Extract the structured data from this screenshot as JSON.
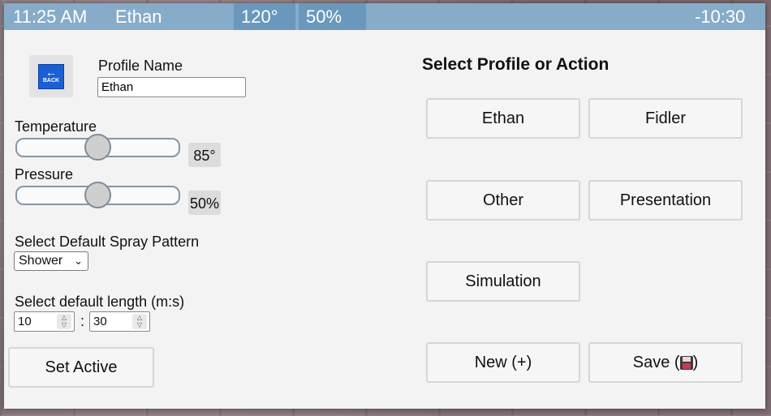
{
  "status_bar": {
    "time": "11:25 AM",
    "user": "Ethan",
    "temperature": "120°",
    "pressure": "50%",
    "remaining": "-10:30"
  },
  "left": {
    "profile_name_label": "Profile Name",
    "profile_name_value": "Ethan",
    "back_label": "BACK",
    "temperature_label": "Temperature",
    "temperature_value": "85°",
    "temperature_level": 0.5,
    "pressure_label": "Pressure",
    "pressure_value": "50%",
    "pressure_level": 0.5,
    "spray_label": "Select Default Spray Pattern",
    "spray_value": "Shower",
    "length_label": "Select default length (m:s)",
    "length_minutes": "10",
    "length_separator": ":",
    "length_seconds": "30",
    "set_active_label": "Set Active"
  },
  "right": {
    "heading": "Select Profile or Action",
    "profiles": [
      "Ethan",
      "Fidler",
      "Other",
      "Presentation",
      "Simulation"
    ],
    "new_label": "New (+)",
    "save_label_prefix": "Save (",
    "save_label_suffix": ")"
  },
  "colors": {
    "status_bar": "#86acc9",
    "status_segment": "#6a98bc",
    "back_icon": "#1a5fd6"
  }
}
